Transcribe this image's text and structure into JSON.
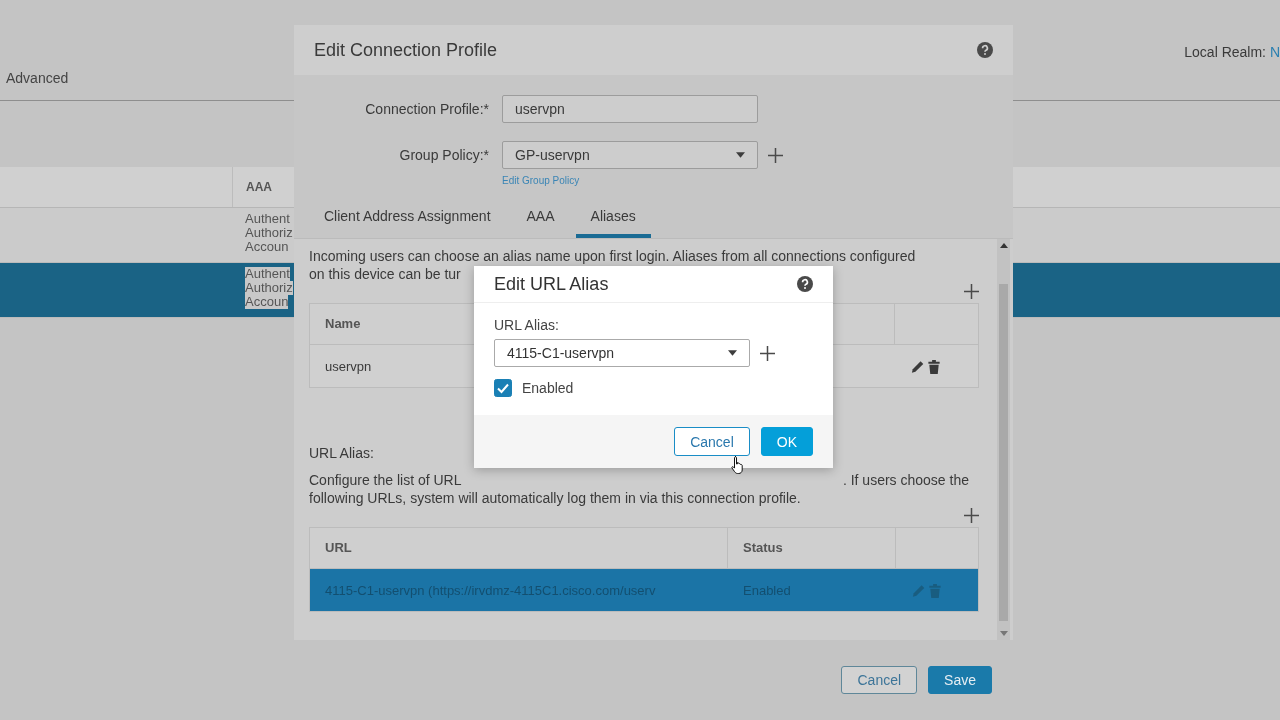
{
  "background": {
    "tabs": [
      {
        "label": "Advanced",
        "selected": false
      }
    ],
    "local_realm": {
      "label": "Local Realm:",
      "value": "N"
    },
    "table": {
      "columns": [
        "AAA"
      ],
      "rows": [
        {
          "aaa": [
            "Authent",
            "Authoriz",
            "Accoun"
          ],
          "selected": false
        },
        {
          "aaa": [
            "Authent",
            "Authoriz",
            "Accoun"
          ],
          "selected": true
        }
      ]
    }
  },
  "dialog": {
    "title": "Edit Connection Profile",
    "fields": [
      {
        "kind": "text",
        "label": "Connection Profile:*",
        "value": "uservpn"
      },
      {
        "kind": "select",
        "label": "Group Policy:*",
        "value": "GP-uservpn",
        "link": "Edit Group Policy"
      }
    ],
    "tabs": [
      {
        "label": "Client Address Assignment",
        "selected": false
      },
      {
        "label": "AAA",
        "selected": false
      },
      {
        "label": "Aliases",
        "selected": true
      }
    ],
    "aliases": {
      "intro_line_1": "Incoming users can choose an alias name upon first login. Aliases from all connections configured",
      "intro_line_2": "on this device can be tur",
      "columns": [
        "Name"
      ],
      "rows": [
        {
          "name": "uservpn"
        }
      ]
    },
    "url_alias": {
      "heading": "URL Alias:",
      "description_left": "Configure the list of URL",
      "description_right": ". If users choose the",
      "description_line_2": "following URLs, system will automatically log them in via this connection profile.",
      "columns": [
        "URL",
        "Status"
      ],
      "rows": [
        {
          "url": "4115-C1-uservpn (https://irvdmz-4115C1.cisco.com/userv",
          "status": "Enabled",
          "selected": true
        }
      ]
    },
    "buttons": [
      {
        "kind": "secondary",
        "label": "Cancel"
      },
      {
        "kind": "primary",
        "label": "Save"
      }
    ]
  },
  "popup": {
    "title": "Edit URL Alias",
    "field_label": "URL Alias:",
    "value": "4115-C1-uservpn",
    "enabled": {
      "label": "Enabled",
      "checked": true
    },
    "buttons": [
      {
        "kind": "secondary",
        "label": "Cancel"
      },
      {
        "kind": "primary",
        "label": "OK"
      }
    ]
  }
}
